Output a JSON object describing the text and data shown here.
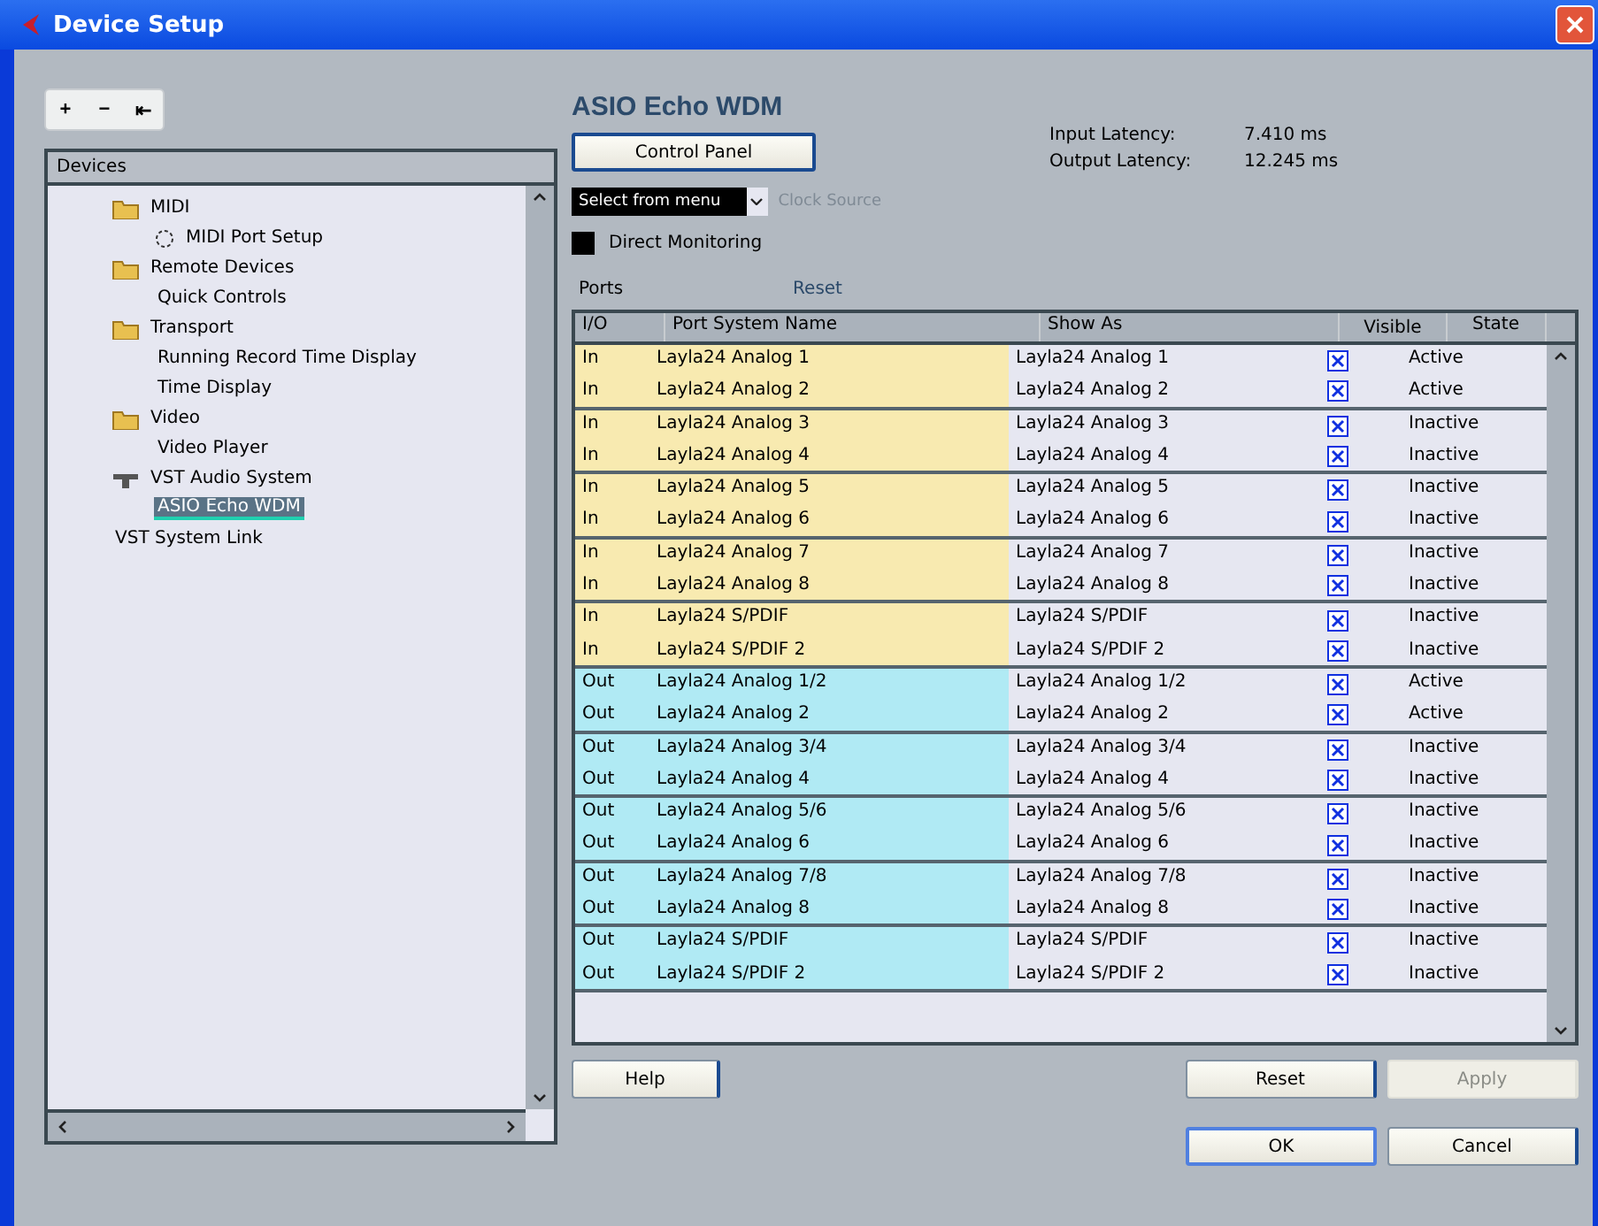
{
  "window": {
    "title": "Device Setup"
  },
  "toolbar": [
    "+",
    "−",
    "⇤"
  ],
  "tree": {
    "header": "Devices",
    "items": [
      {
        "label": "MIDI",
        "kind": "folder",
        "selected": false,
        "children": [
          {
            "label": "MIDI Port Setup",
            "kind": "midi",
            "selected": false
          }
        ]
      },
      {
        "label": "Remote Devices",
        "kind": "folder",
        "selected": false,
        "children": [
          {
            "label": "Quick Controls",
            "kind": "none",
            "selected": false
          }
        ]
      },
      {
        "label": "Transport",
        "kind": "folder",
        "selected": false,
        "children": [
          {
            "label": "Running Record Time Display",
            "kind": "none",
            "selected": false
          },
          {
            "label": "Time Display",
            "kind": "none",
            "selected": false
          }
        ]
      },
      {
        "label": "Video",
        "kind": "folder",
        "selected": false,
        "children": [
          {
            "label": "Video Player",
            "kind": "none",
            "selected": false
          }
        ]
      },
      {
        "label": "VST Audio System",
        "kind": "audio",
        "selected": false,
        "children": [
          {
            "label": "ASIO Echo WDM",
            "kind": "none",
            "selected": true
          }
        ]
      },
      {
        "label": "VST System Link",
        "kind": "none",
        "selected": false
      }
    ]
  },
  "panel": {
    "title": "ASIO Echo WDM",
    "control_panel": "Control Panel",
    "clock_select": "Select from menu",
    "clock_label": "Clock Source",
    "direct_monitoring": {
      "label": "Direct Monitoring",
      "checked": true
    },
    "input_latency_label": "Input Latency:",
    "input_latency": "7.410 ms",
    "output_latency_label": "Output Latency:",
    "output_latency": "12.245 ms",
    "ports_label": "Ports",
    "reset_label": "Reset"
  },
  "table": {
    "columns": [
      "I/O",
      "Port System Name",
      "Show As",
      "Visible",
      "State"
    ],
    "rows": [
      {
        "io": "In",
        "name": "Layla24 Analog 1",
        "show_as": "Layla24 Analog 1",
        "visible": true,
        "state": "Active"
      },
      {
        "io": "In",
        "name": "Layla24 Analog 2",
        "show_as": "Layla24 Analog 2",
        "visible": true,
        "state": "Active"
      },
      {
        "io": "In",
        "name": "Layla24 Analog 3",
        "show_as": "Layla24 Analog 3",
        "visible": true,
        "state": "Inactive"
      },
      {
        "io": "In",
        "name": "Layla24 Analog 4",
        "show_as": "Layla24 Analog 4",
        "visible": true,
        "state": "Inactive"
      },
      {
        "io": "In",
        "name": "Layla24 Analog 5",
        "show_as": "Layla24 Analog 5",
        "visible": true,
        "state": "Inactive"
      },
      {
        "io": "In",
        "name": "Layla24 Analog 6",
        "show_as": "Layla24 Analog 6",
        "visible": true,
        "state": "Inactive"
      },
      {
        "io": "In",
        "name": "Layla24 Analog 7",
        "show_as": "Layla24 Analog 7",
        "visible": true,
        "state": "Inactive"
      },
      {
        "io": "In",
        "name": "Layla24 Analog 8",
        "show_as": "Layla24 Analog 8",
        "visible": true,
        "state": "Inactive"
      },
      {
        "io": "In",
        "name": "Layla24 S/PDIF",
        "show_as": "Layla24 S/PDIF",
        "visible": true,
        "state": "Inactive"
      },
      {
        "io": "In",
        "name": "Layla24 S/PDIF 2",
        "show_as": "Layla24 S/PDIF 2",
        "visible": true,
        "state": "Inactive"
      },
      {
        "io": "Out",
        "name": "Layla24 Analog 1/2",
        "show_as": "Layla24 Analog 1/2",
        "visible": true,
        "state": "Active"
      },
      {
        "io": "Out",
        "name": "Layla24 Analog 2",
        "show_as": "Layla24 Analog 2",
        "visible": true,
        "state": "Active"
      },
      {
        "io": "Out",
        "name": "Layla24 Analog 3/4",
        "show_as": "Layla24 Analog 3/4",
        "visible": true,
        "state": "Inactive"
      },
      {
        "io": "Out",
        "name": "Layla24 Analog 4",
        "show_as": "Layla24 Analog 4",
        "visible": true,
        "state": "Inactive"
      },
      {
        "io": "Out",
        "name": "Layla24 Analog 5/6",
        "show_as": "Layla24 Analog 5/6",
        "visible": true,
        "state": "Inactive"
      },
      {
        "io": "Out",
        "name": "Layla24 Analog 6",
        "show_as": "Layla24 Analog 6",
        "visible": true,
        "state": "Inactive"
      },
      {
        "io": "Out",
        "name": "Layla24 Analog 7/8",
        "show_as": "Layla24 Analog 7/8",
        "visible": true,
        "state": "Inactive"
      },
      {
        "io": "Out",
        "name": "Layla24 Analog 8",
        "show_as": "Layla24 Analog 8",
        "visible": true,
        "state": "Inactive"
      },
      {
        "io": "Out",
        "name": "Layla24 S/PDIF",
        "show_as": "Layla24 S/PDIF",
        "visible": true,
        "state": "Inactive"
      },
      {
        "io": "Out",
        "name": "Layla24 S/PDIF 2",
        "show_as": "Layla24 S/PDIF 2",
        "visible": true,
        "state": "Inactive"
      }
    ]
  },
  "buttons": {
    "help": "Help",
    "reset": "Reset",
    "apply": {
      "label": "Apply",
      "disabled": true
    },
    "ok": "OK",
    "cancel": "Cancel"
  }
}
